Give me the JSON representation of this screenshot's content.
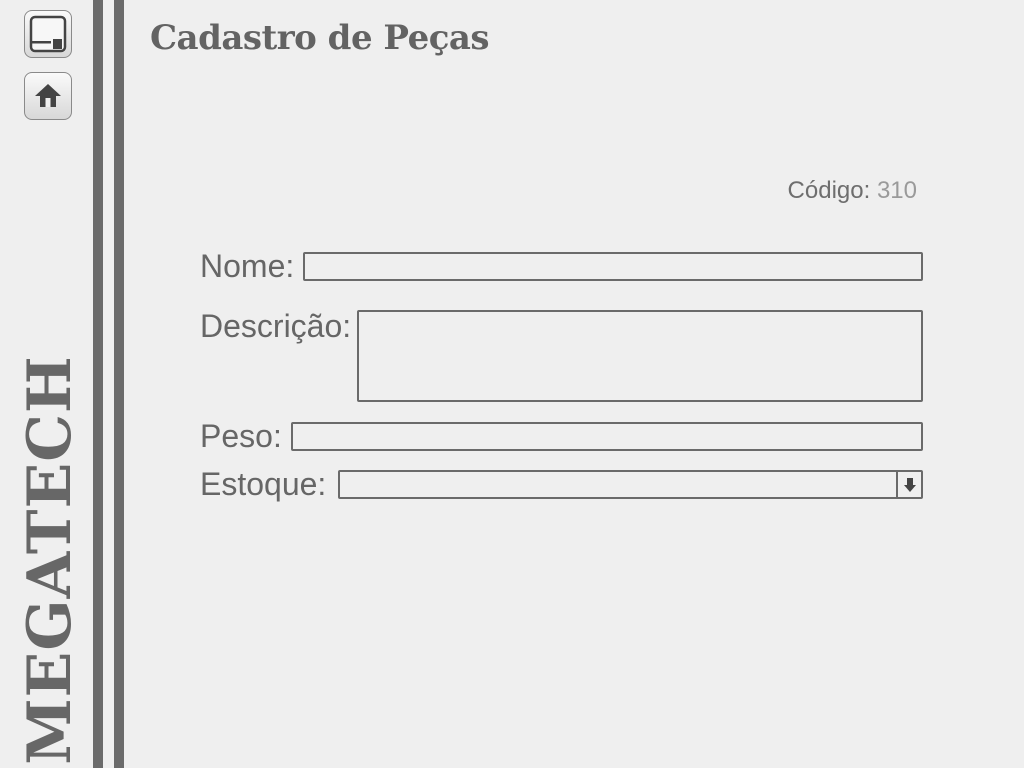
{
  "brand": "MEGATECH",
  "toolbar": {
    "save_icon": "floppy-disk-icon",
    "home_icon": "home-icon"
  },
  "page": {
    "title": "Cadastro de Peças"
  },
  "codigo": {
    "label": "Código:",
    "value": "310"
  },
  "form": {
    "nome": {
      "label": "Nome:",
      "value": "",
      "placeholder": ""
    },
    "descricao": {
      "label": "Descrição:",
      "value": "",
      "placeholder": ""
    },
    "peso": {
      "label": "Peso:",
      "value": "",
      "placeholder": ""
    },
    "estoque": {
      "label": "Estoque:",
      "selected": "",
      "arrow_icon": "arrow-down-icon"
    }
  },
  "colors": {
    "background": "#efefef",
    "sidebar_bars": "#6b6b6b",
    "text": "#666666",
    "muted_value": "#9a9a9a"
  }
}
